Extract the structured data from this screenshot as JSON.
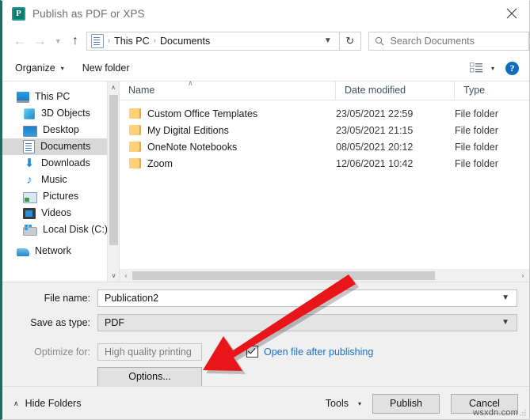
{
  "window": {
    "title": "Publish as PDF or XPS",
    "app_icon": "publisher-icon",
    "app_icon_letter": "P",
    "close_icon": "close-icon",
    "accent_border": "#1f6b62"
  },
  "navbar": {
    "back_icon": "back-arrow-icon",
    "forward_icon": "forward-arrow-icon",
    "history_icon": "chevron-down-icon",
    "up_icon": "up-arrow-icon",
    "breadcrumb": {
      "location_icon": "documents-folder-icon",
      "items": [
        "This PC",
        "Documents"
      ],
      "separator": "›",
      "dropdown_icon": "chevron-down-icon"
    },
    "refresh_icon": "refresh-icon",
    "refresh_glyph": "↻",
    "search": {
      "icon": "search-icon",
      "placeholder": "Search Documents",
      "value": ""
    }
  },
  "toolbar": {
    "organize_label": "Organize",
    "organize_caret": "▾",
    "new_folder_label": "New folder",
    "view_icon": "list-view-icon",
    "view_caret": "▾",
    "help_icon": "help-icon",
    "help_glyph": "?"
  },
  "sidebar": {
    "items": [
      {
        "label": "This PC",
        "icon": "this-pc-icon",
        "selected": false
      },
      {
        "label": "3D Objects",
        "icon": "3d-objects-icon",
        "selected": false
      },
      {
        "label": "Desktop",
        "icon": "desktop-icon",
        "selected": false
      },
      {
        "label": "Documents",
        "icon": "documents-icon",
        "selected": true
      },
      {
        "label": "Downloads",
        "icon": "downloads-icon",
        "selected": false
      },
      {
        "label": "Music",
        "icon": "music-icon",
        "selected": false
      },
      {
        "label": "Pictures",
        "icon": "pictures-icon",
        "selected": false
      },
      {
        "label": "Videos",
        "icon": "videos-icon",
        "selected": false
      },
      {
        "label": "Local Disk (C:)",
        "icon": "local-disk-icon",
        "selected": false
      },
      {
        "label": "Network",
        "icon": "network-icon",
        "selected": false
      }
    ],
    "scroll_up_icon": "chevron-up-icon",
    "scroll_down_icon": "chevron-down-icon",
    "scroll_up_glyph": "∧",
    "scroll_down_glyph": "∨"
  },
  "file_list": {
    "columns": [
      "Name",
      "Date modified",
      "Type"
    ],
    "sort_indicator": "∧",
    "rows": [
      {
        "name": "Custom Office Templates",
        "date": "23/05/2021 22:59",
        "type": "File folder",
        "icon": "folder-icon"
      },
      {
        "name": "My Digital Editions",
        "date": "23/05/2021 21:15",
        "type": "File folder",
        "icon": "folder-icon"
      },
      {
        "name": "OneNote Notebooks",
        "date": "08/05/2021 20:12",
        "type": "File folder",
        "icon": "folder-icon"
      },
      {
        "name": "Zoom",
        "date": "12/06/2021 10:42",
        "type": "File folder",
        "icon": "folder-icon"
      }
    ],
    "hscroll_left_icon": "chevron-left-icon",
    "hscroll_right_icon": "chevron-right-icon",
    "hscroll_left_glyph": "‹",
    "hscroll_right_glyph": "›"
  },
  "form": {
    "file_name_label": "File name:",
    "file_name_value": "Publication2",
    "file_name_caret": "⌄",
    "save_type_label": "Save as type:",
    "save_type_value": "PDF",
    "save_type_caret": "⌄",
    "optimize_label": "Optimize for:",
    "optimize_value": "High quality printing",
    "options_button": "Options...",
    "open_after_label": "Open file after publishing",
    "open_after_checked": true,
    "link_color": "#1a6fc4"
  },
  "footer": {
    "hide_folders_label": "Hide Folders",
    "hide_folders_caret": "∧",
    "tools_label": "Tools",
    "tools_caret": "▾",
    "publish_label": "Publish",
    "cancel_label": "Cancel",
    "resize_grip_icon": "resize-grip-icon"
  },
  "annotation": {
    "arrow_color": "#e8161a",
    "arrow_description": "red-arrow-pointing-to-options-button"
  },
  "watermark": {
    "text": "wsxdn.com"
  }
}
